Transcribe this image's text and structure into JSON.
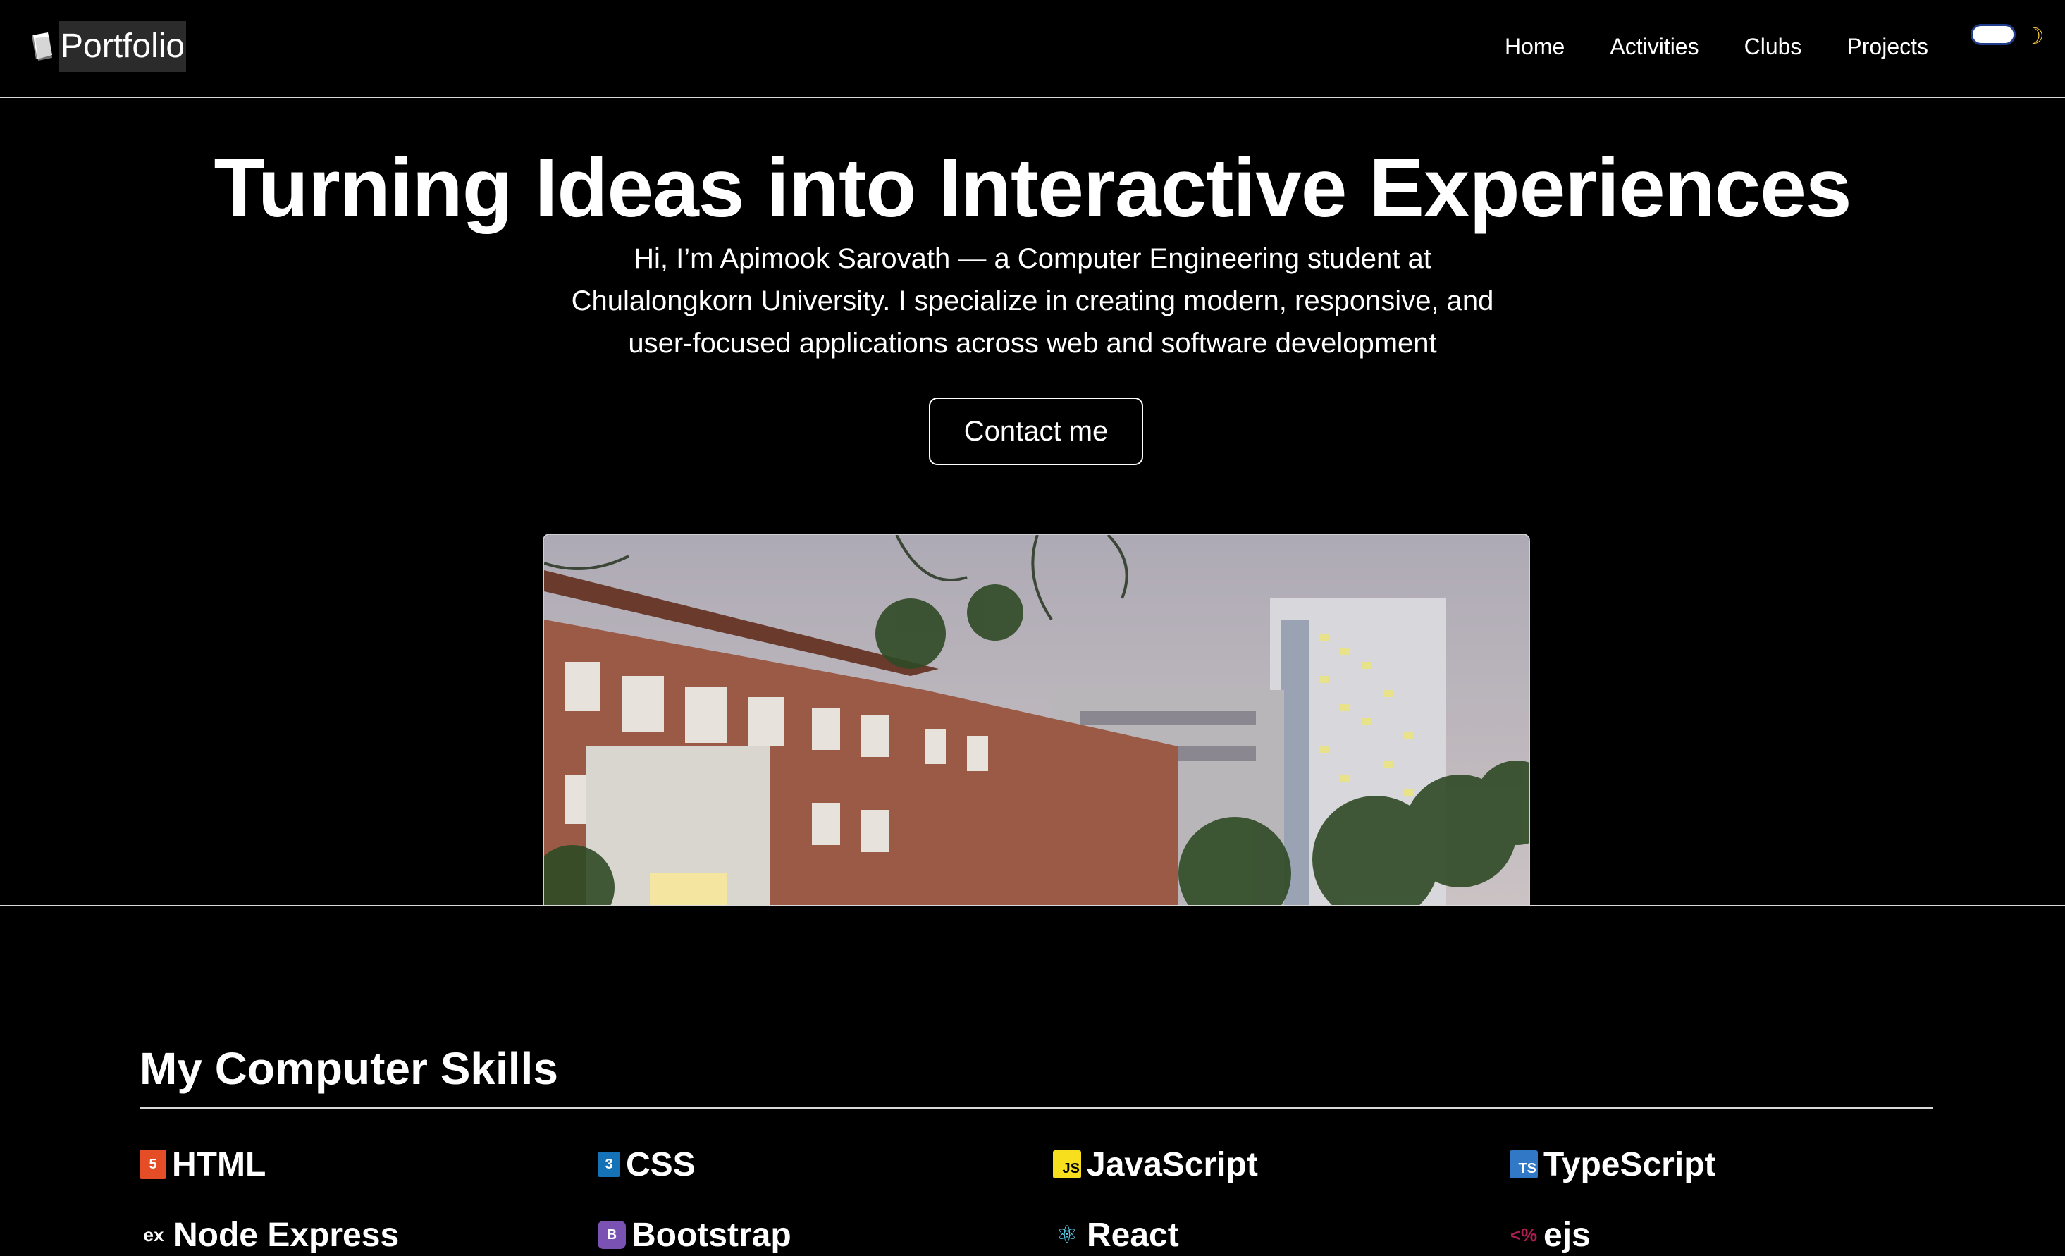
{
  "nav": {
    "brand": "Portfolio",
    "links": [
      "Home",
      "Activities",
      "Clubs",
      "Projects"
    ],
    "theme_icon": "moon-icon"
  },
  "hero": {
    "title": "Turning Ideas into Interactive Experiences",
    "description": "Hi, I’m Apimook Sarovath — a Computer Engineering student at Chulalongkorn University. I specialize in creating modern, responsive, and user-focused applications across web and software development",
    "cta": "Contact me",
    "image_alt": "Chulalongkorn University campus buildings"
  },
  "skills": {
    "title": "My Computer Skills",
    "items": [
      {
        "label": "HTML",
        "icon": "html5-icon",
        "color": "#e44d26"
      },
      {
        "label": "CSS",
        "icon": "css3-icon",
        "color": "#1572b6"
      },
      {
        "label": "JavaScript",
        "icon": "javascript-icon",
        "color": "#f7df1e"
      },
      {
        "label": "TypeScript",
        "icon": "typescript-icon",
        "color": "#3178c6"
      },
      {
        "label": "Node Express",
        "icon": "express-icon",
        "color": "#ffffff"
      },
      {
        "label": "Bootstrap",
        "icon": "bootstrap-icon",
        "color": "#7952b3"
      },
      {
        "label": "React",
        "icon": "react-icon",
        "color": "#61dafb"
      },
      {
        "label": "ejs",
        "icon": "ejs-icon",
        "color": "#a91e50"
      }
    ]
  }
}
